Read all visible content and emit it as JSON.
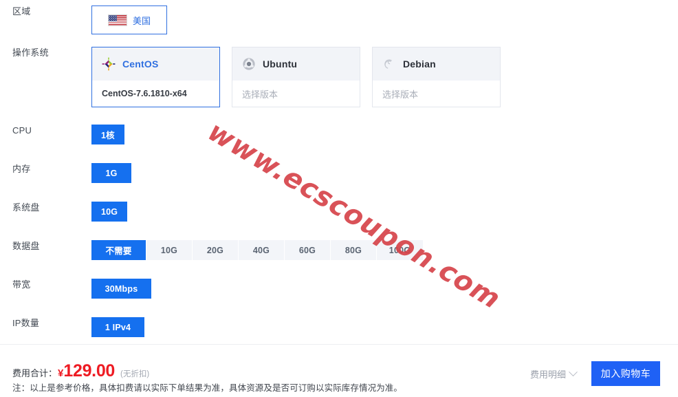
{
  "rows": {
    "region": {
      "label": "区域",
      "selected": "美国",
      "icon": "us-flag-icon"
    },
    "os": {
      "label": "操作系统"
    },
    "cpu": {
      "label": "CPU",
      "options": [
        "1核"
      ],
      "selected": "1核"
    },
    "memory": {
      "label": "内存",
      "options": [
        "1G"
      ],
      "selected": "1G"
    },
    "system_disk": {
      "label": "系统盘",
      "options": [
        "10G"
      ],
      "selected": "10G"
    },
    "data_disk": {
      "label": "数据盘",
      "options": [
        "不需要",
        "10G",
        "20G",
        "40G",
        "60G",
        "80G",
        "100G"
      ],
      "selected": "不需要"
    },
    "bandwidth": {
      "label": "带宽",
      "options": [
        "30Mbps"
      ],
      "selected": "30Mbps"
    },
    "ip_count": {
      "label": "IP数量",
      "options": [
        "1 IPv4"
      ],
      "selected": "1 IPv4"
    }
  },
  "os_cards": [
    {
      "name": "CentOS",
      "version": "CentOS-7.6.1810-x64",
      "selected": true,
      "icon": "centos-logo-icon"
    },
    {
      "name": "Ubuntu",
      "version": "选择版本",
      "selected": false,
      "icon": "ubuntu-logo-icon"
    },
    {
      "name": "Debian",
      "version": "选择版本",
      "selected": false,
      "icon": "debian-logo-icon"
    }
  ],
  "watermark": {
    "text": "www.ecscoupon.com",
    "color": "#d6444a"
  },
  "footer": {
    "total_label": "费用合计：",
    "currency": "¥",
    "amount": "129.00",
    "discount_note": "(无折扣)",
    "fine_print": "注：以上是参考价格，具体扣费请以实际下单结果为准，具体资源及是否可订购以实际库存情况为准。",
    "detail_toggle": "费用明细",
    "cart_button": "加入购物车"
  },
  "colors": {
    "accent_blue": "#1570ef",
    "button_blue": "#1f61f5",
    "price_red": "#ee1b23",
    "chip_bg": "#f3f5f9"
  }
}
